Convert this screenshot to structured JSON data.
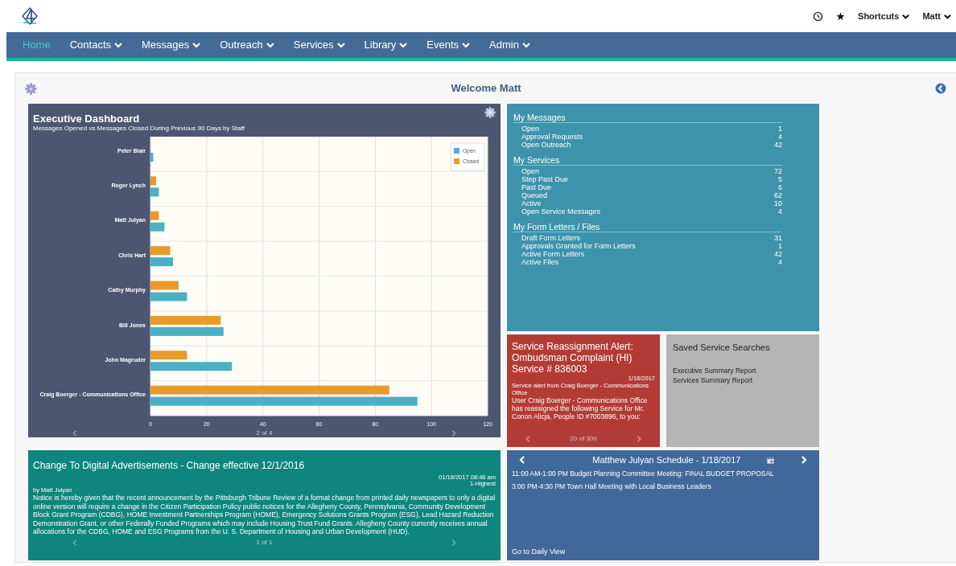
{
  "header": {
    "menu": [
      {
        "label": "Shortcuts"
      },
      {
        "label": "Matt"
      }
    ]
  },
  "nav": [
    {
      "label": "Home",
      "selected": true,
      "dropdown": false
    },
    {
      "label": "Contacts",
      "selected": false,
      "dropdown": true
    },
    {
      "label": "Messages",
      "selected": false,
      "dropdown": true
    },
    {
      "label": "Outreach",
      "selected": false,
      "dropdown": true
    },
    {
      "label": "Services",
      "selected": false,
      "dropdown": true
    },
    {
      "label": "Library",
      "selected": false,
      "dropdown": true
    },
    {
      "label": "Events",
      "selected": false,
      "dropdown": true
    },
    {
      "label": "Admin",
      "selected": false,
      "dropdown": true
    }
  ],
  "welcome": "Welcome Matt",
  "dashboard": {
    "title": "Executive Dashboard",
    "subtitle": "Messages Opened vs Messages Closed During Previous 90 Days by Staff",
    "pager": "2 of 4",
    "chart_data": {
      "type": "bar",
      "orientation": "horizontal",
      "categories": [
        "Peter Blair",
        "Roger Lynch",
        "Matt Julyan",
        "Chris Hart",
        "Cathy Murphy",
        "Bill Jones",
        "John Magruder",
        "Craig Boerger - Communications Office"
      ],
      "series": [
        {
          "name": "Open",
          "color": "#4ab0c6",
          "values": [
            1,
            3,
            5,
            8,
            13,
            26,
            29,
            95
          ]
        },
        {
          "name": "Closed",
          "color": "#e99a2c",
          "values": [
            0,
            2,
            3,
            7,
            10,
            25,
            13,
            85
          ]
        }
      ],
      "xlim": [
        0,
        120
      ],
      "grid": true,
      "legend": true,
      "xticks": [
        0,
        20,
        40,
        60,
        80,
        100,
        120
      ]
    }
  },
  "summary": {
    "sections": [
      {
        "title": "My Messages",
        "items": [
          {
            "label": "Open",
            "count": "1"
          },
          {
            "label": "Approval Requests",
            "count": "4"
          },
          {
            "label": "Open Outreach",
            "count": "42"
          }
        ]
      },
      {
        "title": "My Services",
        "items": [
          {
            "label": "Open",
            "count": "72"
          },
          {
            "label": "Step Past Due",
            "count": "5"
          },
          {
            "label": "Past Due",
            "count": "6"
          },
          {
            "label": "Queued",
            "count": "62"
          },
          {
            "label": "Active",
            "count": "10"
          },
          {
            "label": "Open Service Messages",
            "count": "4"
          }
        ]
      },
      {
        "title": "My Form Letters / Files",
        "items": [
          {
            "label": "Draft Form Letters",
            "count": "31"
          },
          {
            "label": "Approvals Granted for Form Letters",
            "count": "1"
          },
          {
            "label": "Active Form Letters",
            "count": "42"
          },
          {
            "label": "Active Files",
            "count": "4"
          }
        ]
      }
    ]
  },
  "alert": {
    "title": "Service Reassignment Alert: Ombudsman Complaint (HI) Service # 836003",
    "date": "1/18/2017",
    "from": "Service alert from Craig Boerger - Communications Office",
    "body": "User Craig Boerger - Communications Office has reassigned the following Service for Mr. Conon Alicja, People ID #7003896, to you:",
    "pager": "20 of 300"
  },
  "saved_searches": {
    "title": "Saved Service Searches",
    "items": [
      "Executive Summary Report",
      "Services Summary Report"
    ]
  },
  "announcement": {
    "title": "Change To Digital Advertisements - Change effective 12/1/2016",
    "timestamp": "01/18/2017 08:46 am",
    "priority": "1-Highest",
    "author": "by Matt Julyan",
    "body": "Notice is hereby given that the recent announcement by the Pittsburgh Tribune Review of a format change from printed daily newspapers to only a digital online version will require a change in the Citizen Participation Policy public notices for the Allegheny County, Pennsylvania, Community Development Block Grant Program (CDBG), HOME Investment Partnerships Program (HOME), Emergency Solutions Grants Program (ESG), Lead Hazard Reduction Demonstration Grant, or other Federally Funded Programs which may include Housing Trust Fund Grants. Allegheny County currently receives annual allocations for the CDBG, HOME and ESG Programs from the U. S. Department of Housing and Urban Development (HUD).",
    "pager": "1 of 1"
  },
  "schedule": {
    "title": "Matthew Julyan Schedule - 1/18/2017",
    "events": [
      "11:00 AM-1:00 PM Budget Planning Committee Meeting: FINAL BUDGET PROPOSAL",
      "3:00 PM-4:30 PM Town Hall Meeting with Local Business Leaders"
    ],
    "link": "Go to Daily View"
  }
}
